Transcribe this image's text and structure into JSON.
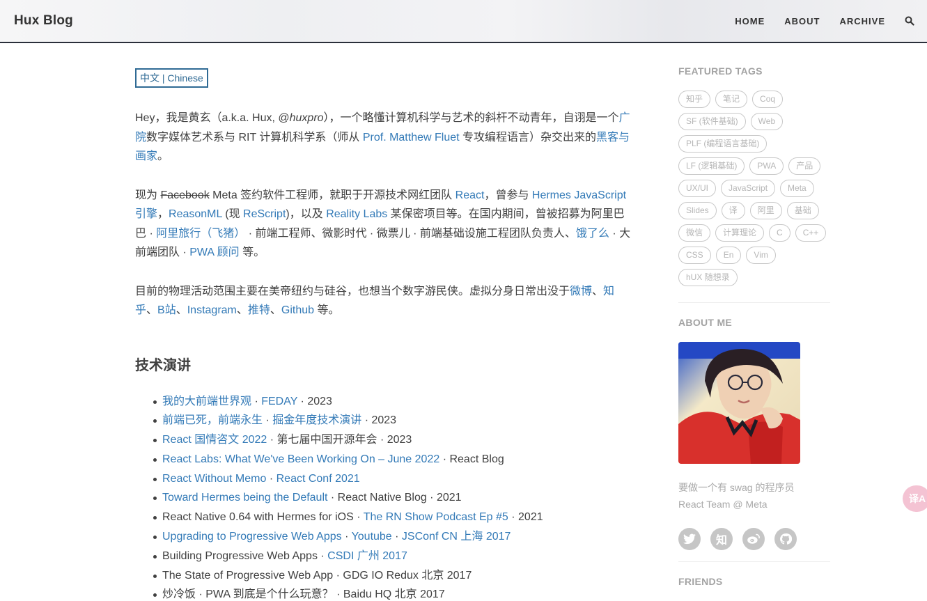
{
  "header": {
    "brand": "Hux Blog",
    "nav": [
      "HOME",
      "ABOUT",
      "ARCHIVE"
    ]
  },
  "main": {
    "lang_button": "中文 | Chinese",
    "p1": {
      "t1": "Hey，我是黄玄（a.k.a. Hux, @",
      "t1_italic": "huxpro",
      "t2": "），一个略懂计算机科学与艺术的斜杆不动青年，自诩是一个",
      "l1": "广院",
      "t3": "数字媒体艺术系与 RIT 计算机科学系（师从 ",
      "l2": "Prof. Matthew Fluet",
      "t4": " 专攻编程语言）杂交出来的",
      "l3": "黑客与画家",
      "t5": "。"
    },
    "p2": {
      "t1": "现为 ",
      "strike": "Facebook",
      "t2": " Meta 签约软件工程师，就职于开源技术网红团队 ",
      "l1": "React",
      "t3": "，曾参与 ",
      "l2": "Hermes JavaScript 引擎",
      "t4": "，",
      "l3": "ReasonML",
      "t5": " (现 ",
      "l4": "ReScript",
      "t6": ")，以及 ",
      "l5": "Reality Labs",
      "t7": " 某保密项目等。在国内期间，曾被招募为阿里巴巴 · ",
      "l6": "阿里旅行（飞猪）",
      "t8": " · 前端工程师、微影时代 · 微票儿 · 前端基础设施工程团队负责人、",
      "l7": "饿了么",
      "t9": " · 大前端团队 · ",
      "l8": "PWA 顾问",
      "t10": " 等。"
    },
    "p3": {
      "t1": "目前的物理活动范围主要在美帝纽约与硅谷，也想当个数字游民侠。虚拟分身日常出没于",
      "l1": "微博",
      "s1": "、",
      "l2": "知乎",
      "s2": "、",
      "l3": "B站",
      "s3": "、",
      "l4": "Instagram",
      "s4": "、",
      "l5": "推特",
      "s5": "、",
      "l6": "Github",
      "t2": " 等。"
    },
    "talks_title": "技术演讲",
    "talks": [
      {
        "a": "我的大前端世界观",
        "sep1": " · ",
        "b": "FEDAY",
        "c": " · 2023"
      },
      {
        "a": "前端已死，前端永生",
        "sep1": " · ",
        "b": "掘金年度技术演讲",
        "c": " · 2023"
      },
      {
        "a": "React 国情咨文 2022",
        "sep1": " · ",
        "b": "",
        "c": "第七届中国开源年会 · 2023"
      },
      {
        "a": "React Labs: What We've Been Working On – June 2022",
        "sep1": " · ",
        "b": "",
        "c": "React Blog"
      },
      {
        "a": "React Without Memo",
        "sep1": " · ",
        "b": "React Conf 2021",
        "c": ""
      },
      {
        "a": "Toward Hermes being the Default",
        "sep1": " · ",
        "b": "",
        "c": "React Native Blog · 2021"
      },
      {
        "pre": "React Native 0.64 with Hermes for iOS",
        "sep1": " · ",
        "b": "The RN Show Podcast Ep #5",
        "c": " · 2021"
      },
      {
        "a": "Upgrading to Progressive Web Apps",
        "sep1": " · ",
        "b": "Youtube",
        "sep2": " · ",
        "b2": "JSConf CN 上海 2017",
        "c": ""
      },
      {
        "pre": "Building Progressive Web Apps",
        "sep1": " · ",
        "b": "CSDI 广州 2017",
        "c": ""
      },
      {
        "pre": "The State of Progressive Web App",
        "sep1": " · ",
        "b": "",
        "c": "GDG IO Redux 北京 2017"
      },
      {
        "pre": "炒冷饭",
        "sep1": " · ",
        "b": "",
        "c": "PWA 到底是个什么玩意？ · Baidu HQ 北京 2017"
      }
    ]
  },
  "sidebar": {
    "featured_tags_title": "FEATURED TAGS",
    "tags": [
      "知乎",
      "笔记",
      "Coq",
      "SF (软件基础)",
      "Web",
      "PLF (编程语言基础)",
      "LF (逻辑基础)",
      "PWA",
      "产品",
      "UX/UI",
      "JavaScript",
      "Meta",
      "Slides",
      "译",
      "阿里",
      "基础",
      "微信",
      "计算理论",
      "C",
      "C++",
      "CSS",
      "En",
      "Vim",
      "hUX 随想录"
    ],
    "about_title": "ABOUT ME",
    "bio_line1": "要做一个有 swag 的程序员",
    "bio_line2": "React Team @ Meta",
    "social_icons": [
      "twitter-icon",
      "zhihu-icon",
      "weibo-icon",
      "github-icon"
    ],
    "zhihu_glyph": "知",
    "friends_title": "FRIENDS"
  },
  "fab": {
    "label": "译A"
  },
  "colors": {
    "link": "#337ab7",
    "text": "#404040",
    "muted": "#a3a3a3",
    "nav_border": "#2a2f3a"
  }
}
